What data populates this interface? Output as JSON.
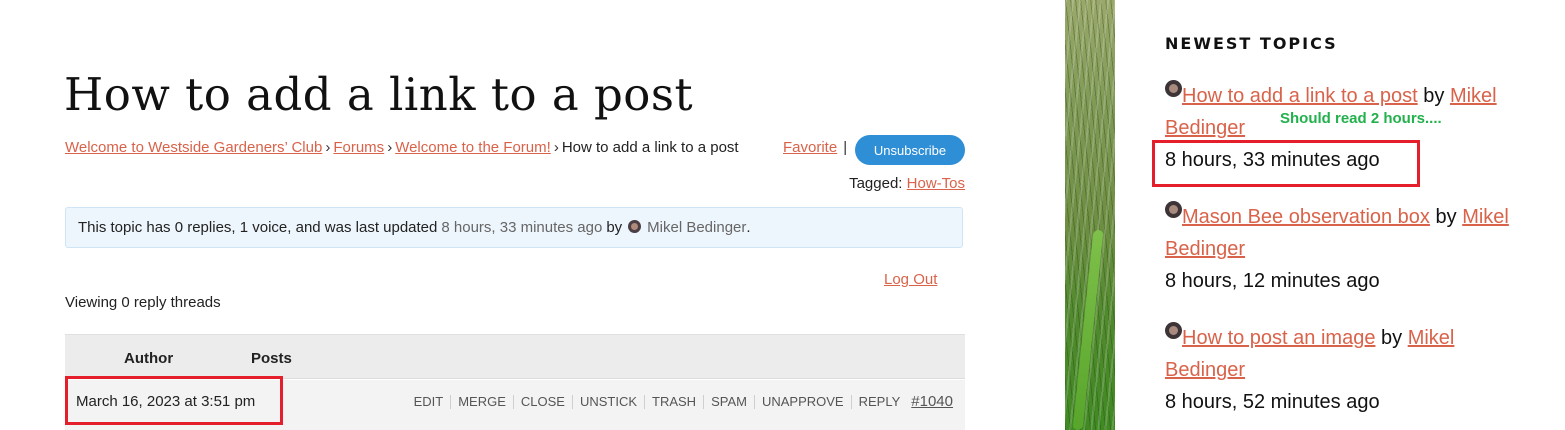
{
  "page": {
    "title": "How to add a link to a post"
  },
  "breadcrumb": {
    "items": [
      "Welcome to Westside Gardeners’ Club",
      "Forums",
      "Welcome to the Forum!"
    ],
    "separator": "›",
    "current": "How to add a link to a post"
  },
  "actions": {
    "favorite_label": "Favorite",
    "divider": "|",
    "unsubscribe_label": "Unsubscribe"
  },
  "tags": {
    "label": "Tagged:",
    "items": [
      "How-Tos"
    ]
  },
  "notice": {
    "text": "This topic has 0 replies, 1 voice, and was last updated",
    "freshness": "8 hours, 33 minutes ago",
    "by": "by",
    "author": "Mikel Bedinger",
    "end": "."
  },
  "account": {
    "logout_label": "Log Out"
  },
  "replies": {
    "viewing_text": "Viewing 0 reply threads"
  },
  "table": {
    "headers": [
      "Author",
      "Posts"
    ],
    "row": {
      "date": "March 16, 2023 at 3:51 pm",
      "admin_links": [
        "EDIT",
        "MERGE",
        "CLOSE",
        "UNSTICK",
        "TRASH",
        "SPAM",
        "UNAPPROVE",
        "REPLY"
      ],
      "permalink": "#1040"
    }
  },
  "sidebar": {
    "widget_title": "NEWEST TOPICS",
    "topics": [
      {
        "title": "How to add a link to a post",
        "by": "by",
        "author": "Mikel Bedinger",
        "time": "8 hours, 33 minutes ago"
      },
      {
        "title": "Mason Bee observation box",
        "by": "by",
        "author": "Mikel Bedinger",
        "time": "8 hours, 12 minutes ago"
      },
      {
        "title": "How to post an image",
        "by": "by",
        "author": "Mikel Bedinger",
        "time": "8 hours, 52 minutes ago"
      }
    ]
  },
  "annotation": {
    "text": "Should read 2 hours....",
    "color": "#22b14c"
  },
  "colors": {
    "link": "#d9634a",
    "button": "#2f8fd6",
    "highlight_box": "#e41f2b",
    "notice_bg": "#eef6fd"
  },
  "icons": {
    "avatar": "avatar-icon"
  }
}
